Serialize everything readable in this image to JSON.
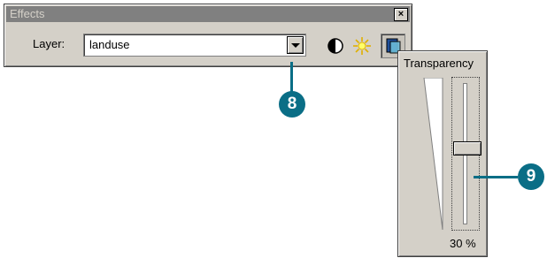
{
  "window": {
    "title": "Effects"
  },
  "layer": {
    "label": "Layer:",
    "value": "landuse"
  },
  "transparency": {
    "title": "Transparency",
    "level_percent": 30,
    "readout": "30 %"
  },
  "callouts": {
    "combo": "8",
    "slider": "9"
  },
  "colors": {
    "callout": "#0a6e86",
    "titlebar": "#808080",
    "face": "#d4d0c8"
  },
  "icons": [
    "close-icon",
    "dropdown-arrow-icon",
    "contrast-icon",
    "brightness-icon",
    "transparency-icon"
  ]
}
